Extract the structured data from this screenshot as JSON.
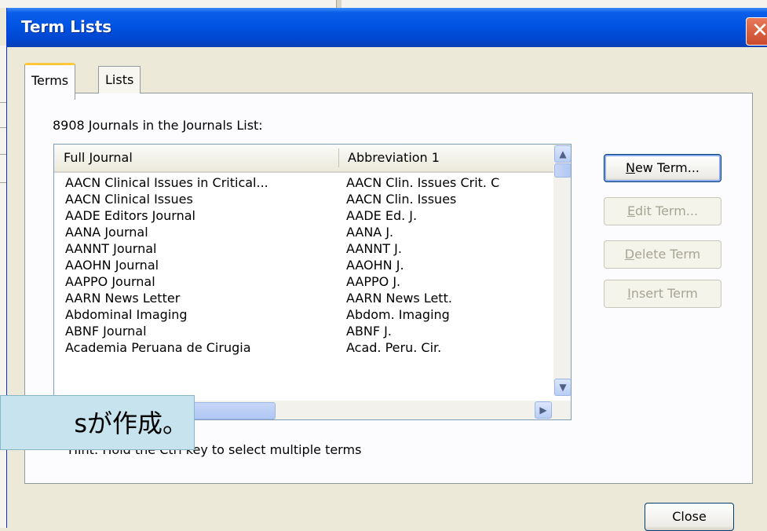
{
  "window": {
    "title": "Term Lists",
    "close_glyph": "✕"
  },
  "tabs": [
    {
      "label": "Terms"
    },
    {
      "label": "Lists"
    }
  ],
  "count_text": "8908 Journals in the Journals List:",
  "list": {
    "columns": [
      "Full Journal",
      "Abbreviation 1"
    ],
    "rows": [
      {
        "full": "AACN Clinical Issues in Critical...",
        "abbr": "AACN Clin. Issues Crit. C"
      },
      {
        "full": "AACN Clinical Issues",
        "abbr": "AACN Clin. Issues"
      },
      {
        "full": "AADE Editors Journal",
        "abbr": "AADE Ed. J."
      },
      {
        "full": "AANA Journal",
        "abbr": "AANA J."
      },
      {
        "full": "AANNT Journal",
        "abbr": "AANNT J."
      },
      {
        "full": "AAOHN Journal",
        "abbr": "AAOHN J."
      },
      {
        "full": "AAPPO Journal",
        "abbr": "AAPPO J."
      },
      {
        "full": "AARN News Letter",
        "abbr": "AARN News Lett."
      },
      {
        "full": "Abdominal Imaging",
        "abbr": "Abdom. Imaging"
      },
      {
        "full": "ABNF Journal",
        "abbr": "ABNF J."
      },
      {
        "full": "Academia Peruana de Cirugia",
        "abbr": "Acad. Peru. Cir."
      }
    ]
  },
  "buttons": {
    "new_term": {
      "key": "N",
      "rest": "ew Term..."
    },
    "edit_term": {
      "key": "E",
      "rest": "dit Term..."
    },
    "delete_term": {
      "key": "D",
      "rest": "elete Term"
    },
    "insert_term": {
      "key": "I",
      "rest": "nsert Term"
    },
    "close": "Close"
  },
  "hint": "Hint: Hold the Ctrl key to select multiple terms",
  "overlay_text": "sが作成。",
  "scroll": {
    "up": "▲",
    "down": "▼",
    "right": "▶"
  }
}
